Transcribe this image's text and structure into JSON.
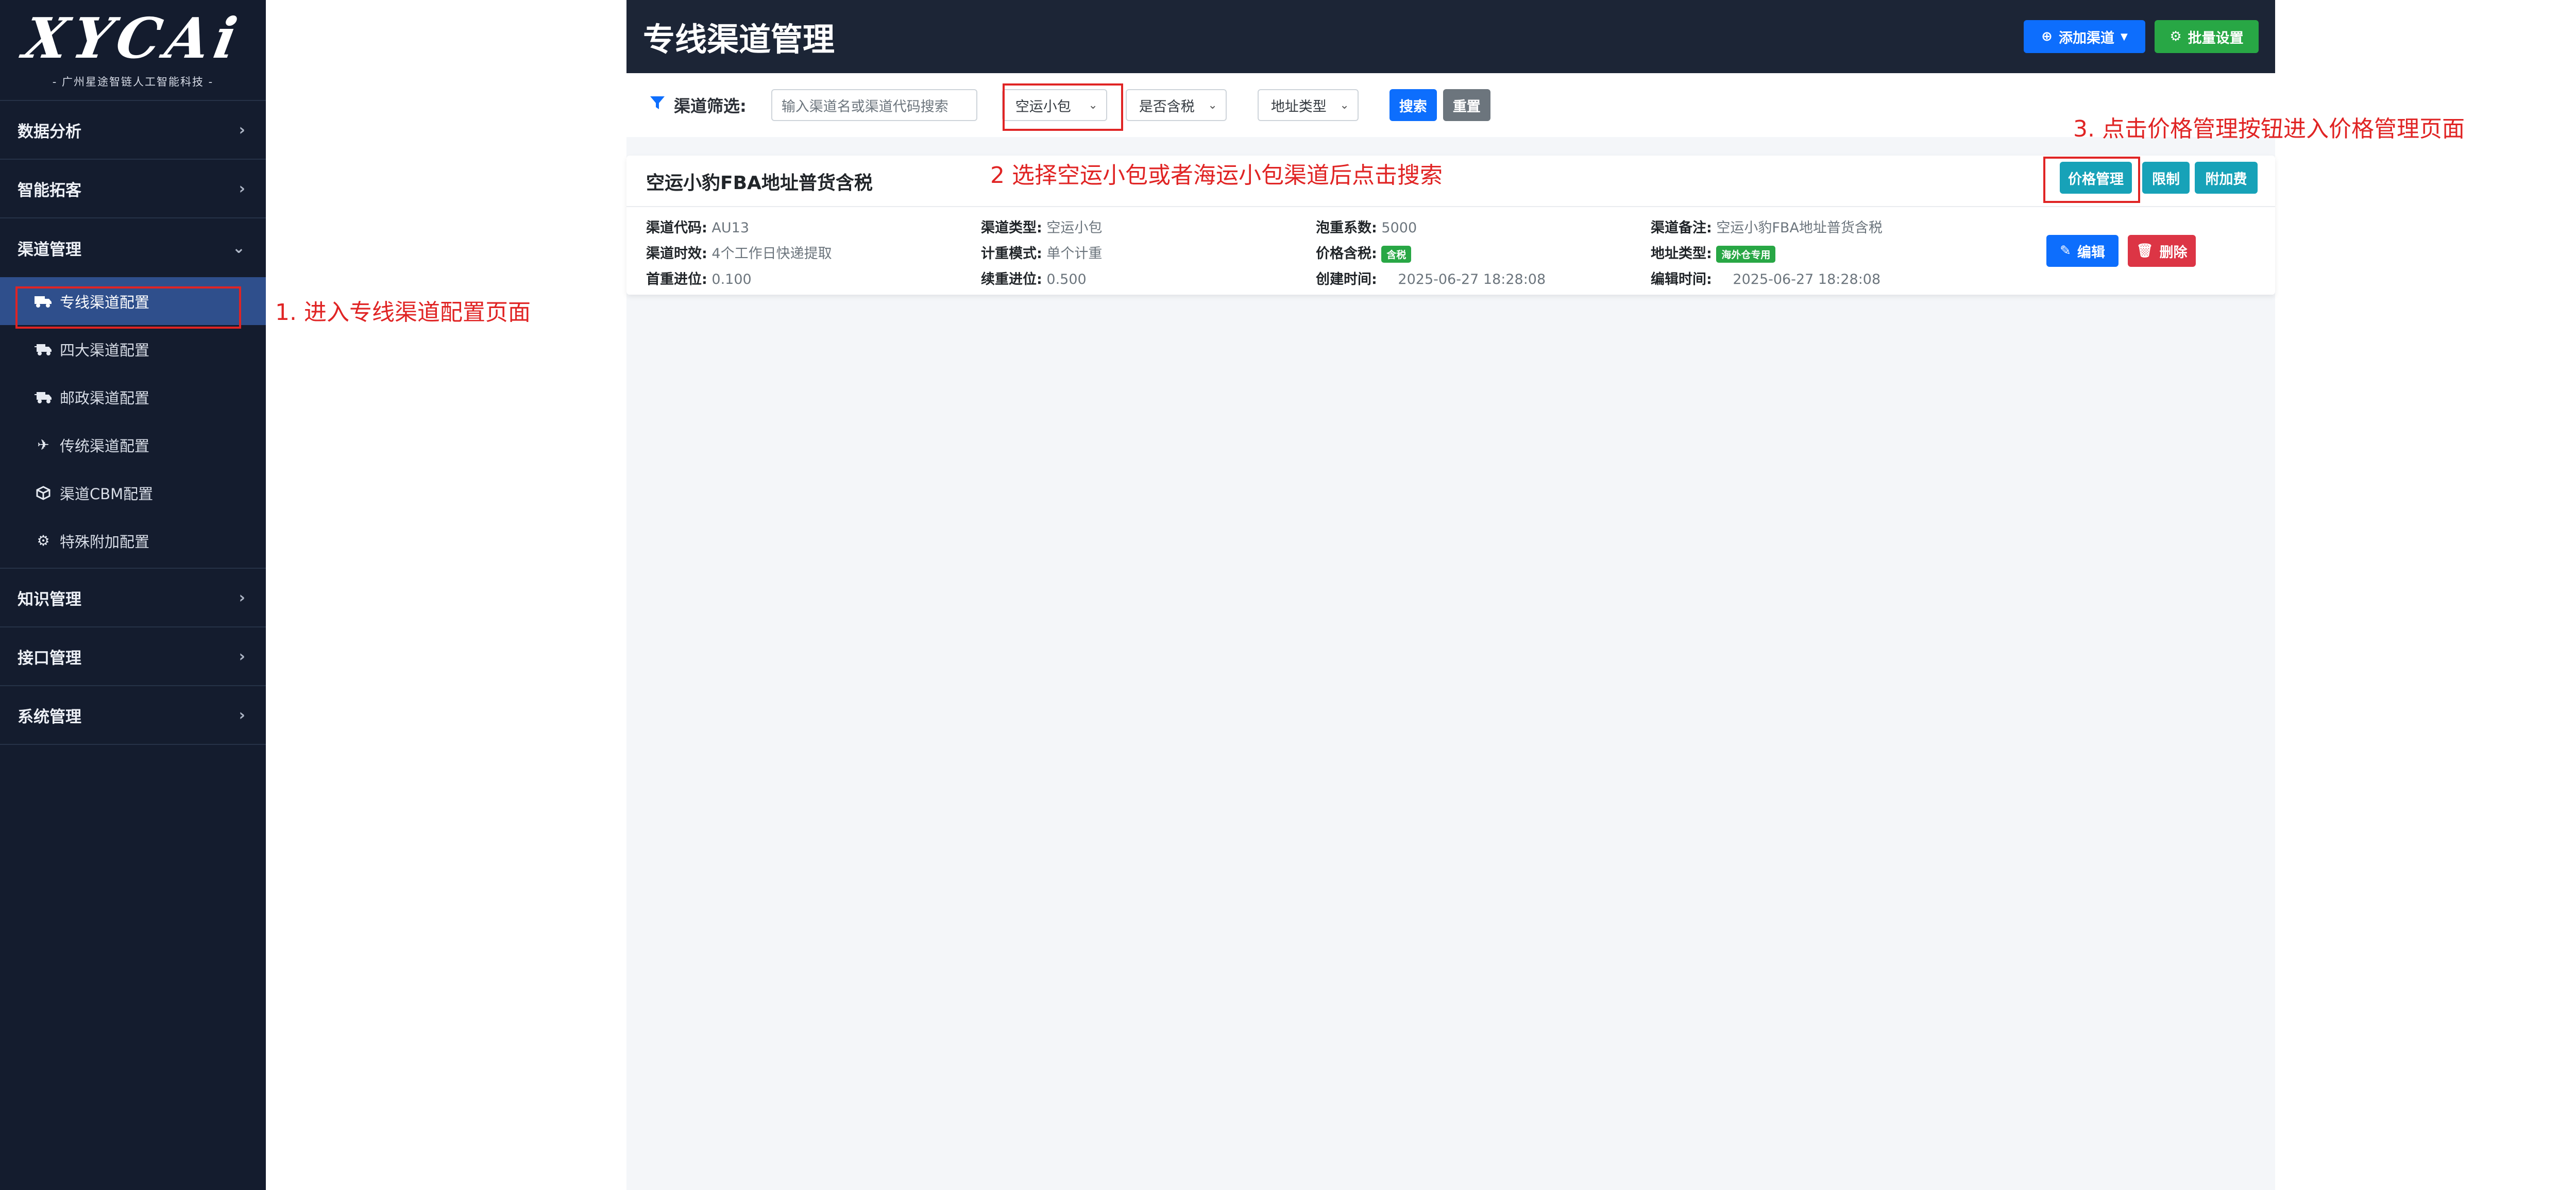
{
  "sidebar": {
    "logo": "XYCAi",
    "logo_sub": "- 广州星途智链人工智能科技 -",
    "groups": [
      {
        "label": "数据分析"
      },
      {
        "label": "智能拓客"
      },
      {
        "label": "渠道管理"
      },
      {
        "label": "知识管理"
      },
      {
        "label": "接口管理"
      },
      {
        "label": "系统管理"
      }
    ],
    "channel_items": [
      {
        "label": "专线渠道配置",
        "icon": "truck-icon"
      },
      {
        "label": "四大渠道配置",
        "icon": "truck-fast-icon"
      },
      {
        "label": "邮政渠道配置",
        "icon": "truck-fast-icon"
      },
      {
        "label": "传统渠道配置",
        "icon": "plane-icon"
      },
      {
        "label": "渠道CBM配置",
        "icon": "cube-icon"
      },
      {
        "label": "特殊附加配置",
        "icon": "gear-icon"
      }
    ]
  },
  "header": {
    "title": "专线渠道管理",
    "add_channel": "添加渠道",
    "batch_settings": "批量设置"
  },
  "filter": {
    "label": "渠道筛选:",
    "search_placeholder": "输入渠道名或渠道代码搜索",
    "channel_type": "空运小包",
    "tax": "是否含税",
    "address_type": "地址类型",
    "search_btn": "搜索",
    "reset_btn": "重置"
  },
  "card": {
    "title": "空运小豹FBA地址普货含税",
    "price_btn": "价格管理",
    "limit_btn": "限制",
    "surcharge_btn": "附加费",
    "edit_btn": "编辑",
    "delete_btn": "删除",
    "fields": {
      "code_label": "渠道代码:",
      "code": "AU13",
      "type_label": "渠道类型:",
      "type": "空运小包",
      "vol_label": "泡重系数:",
      "vol": "5000",
      "remark_label": "渠道备注:",
      "remark": "空运小豹FBA地址普货含税",
      "time_label": "渠道时效:",
      "time": "4个工作日快递提取",
      "mode_label": "计重模式:",
      "mode": "单个计重",
      "tax_label": "价格含税:",
      "tax": "含税",
      "addr_label": "地址类型:",
      "addr": "海外仓专用",
      "first_label": "首重进位:",
      "first": "0.100",
      "cont_label": "续重进位:",
      "cont": "0.500",
      "created_label": "创建时间:",
      "created": "2025-06-27 18:28:08",
      "edited_label": "编辑时间:",
      "edited": "2025-06-27 18:28:08"
    }
  },
  "annotations": {
    "step1": "1. 进入专线渠道配置页面",
    "step2": "2 选择空运小包或者海运小包渠道后点击搜索",
    "step3": "3. 点击价格管理按钮进入价格管理页面"
  },
  "colors": {
    "sidebar_bg": "#141c2e",
    "active_item": "#2f4f8c",
    "topbar_bg": "#1c2536",
    "primary": "#0d6efd",
    "success": "#28a745",
    "teal": "#17a2b8",
    "danger": "#dc3545",
    "annotation": "#e02424"
  }
}
